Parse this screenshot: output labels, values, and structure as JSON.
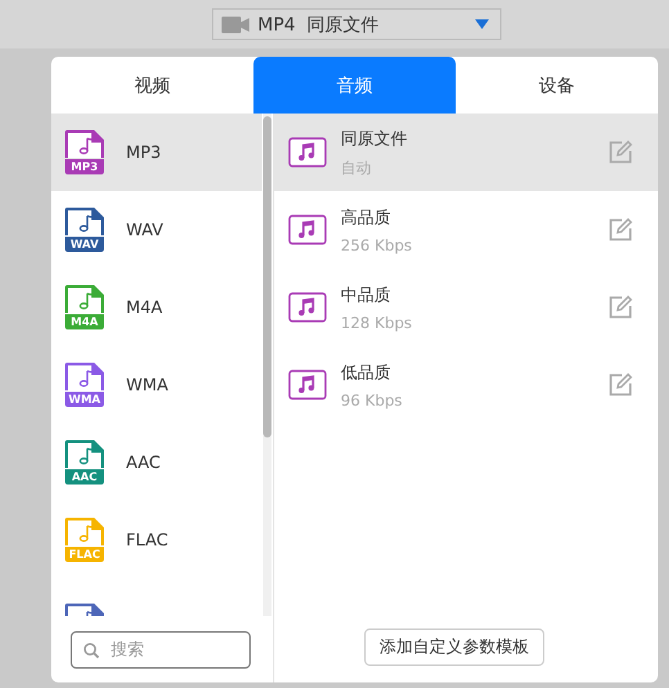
{
  "format_select": {
    "value": "MP4  同原文件"
  },
  "tabs": [
    {
      "label": "视频",
      "selected": false
    },
    {
      "label": "音频",
      "selected": true
    },
    {
      "label": "设备",
      "selected": false
    }
  ],
  "formats": [
    {
      "label": "MP3",
      "badge": "MP3",
      "color": "#a93bb5",
      "selected": true
    },
    {
      "label": "WAV",
      "badge": "WAV",
      "color": "#2d5a9c",
      "selected": false
    },
    {
      "label": "M4A",
      "badge": "M4A",
      "color": "#3bac37",
      "selected": false
    },
    {
      "label": "WMA",
      "badge": "WMA",
      "color": "#8b5ae6",
      "selected": false
    },
    {
      "label": "AAC",
      "badge": "AAC",
      "color": "#14917f",
      "selected": false
    },
    {
      "label": "FLAC",
      "badge": "FLAC",
      "color": "#f6b400",
      "selected": false
    },
    {
      "color": "#4d66b8",
      "selected": false
    }
  ],
  "search": {
    "placeholder": "搜索"
  },
  "presets": [
    {
      "title": "同原文件",
      "detail": "自动",
      "selected": true
    },
    {
      "title": "高品质",
      "detail": "256 Kbps",
      "selected": false
    },
    {
      "title": "中品质",
      "detail": "128 Kbps",
      "selected": false
    },
    {
      "title": "低品质",
      "detail": "96 Kbps",
      "selected": false
    }
  ],
  "add_button": "添加自定义参数模板"
}
